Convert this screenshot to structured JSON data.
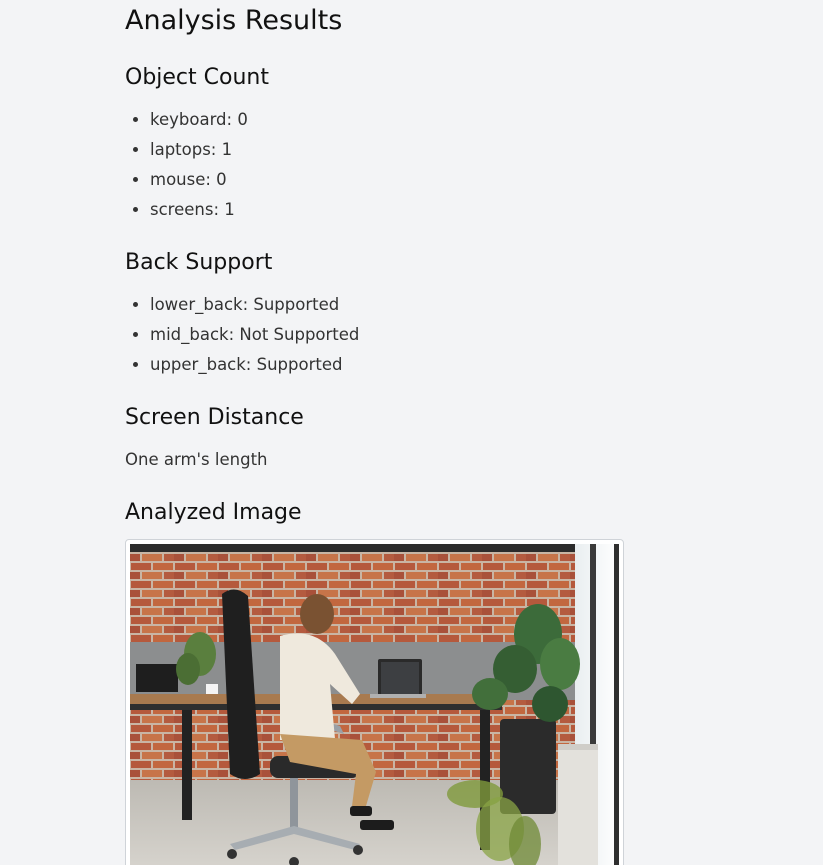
{
  "page": {
    "title": "Analysis Results"
  },
  "object_count": {
    "heading": "Object Count",
    "items": [
      "keyboard: 0",
      "laptops: 1",
      "mouse: 0",
      "screens: 1"
    ]
  },
  "back_support": {
    "heading": "Back Support",
    "items": [
      "lower_back: Supported",
      "mid_back: Not Supported",
      "upper_back: Supported"
    ]
  },
  "screen_distance": {
    "heading": "Screen Distance",
    "value": "One arm's length"
  },
  "analyzed_image": {
    "heading": "Analyzed Image"
  }
}
